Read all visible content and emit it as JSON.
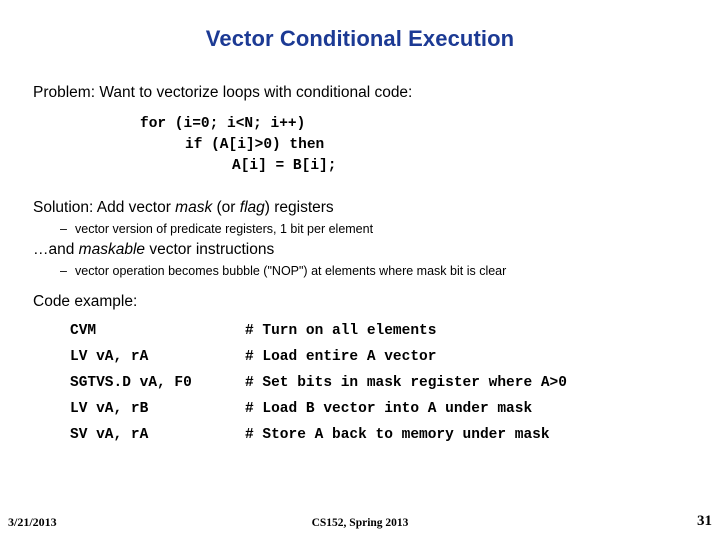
{
  "slide": {
    "title": "Vector Conditional Execution",
    "problem": {
      "heading": "Problem: Want to vectorize loops with conditional code:",
      "code": [
        "for (i=0; i<N; i++)",
        "if (A[i]>0) then",
        "A[i] = B[i];"
      ]
    },
    "solution": {
      "heading_pre": "Solution: Add vector ",
      "heading_em1": "mask",
      "heading_mid": " (or ",
      "heading_em2": "flag",
      "heading_post": ") registers",
      "sub_bullet": "vector version of predicate registers, 1 bit per element",
      "dash": "–"
    },
    "maskable": {
      "heading_pre": "…and ",
      "heading_em": "maskable",
      "heading_post": " vector instructions",
      "sub_bullet": "vector operation becomes bubble (\"NOP\") at elements where mask bit is clear",
      "dash": "–"
    },
    "code_example": {
      "heading": "Code example:",
      "rows": [
        {
          "instruction": "CVM",
          "comment": "# Turn on all elements"
        },
        {
          "instruction": "LV vA, rA",
          "comment": "# Load entire A vector"
        },
        {
          "instruction": "SGTVS.D vA, F0",
          "comment": "# Set bits in mask register where A>0"
        },
        {
          "instruction": "LV vA, rB",
          "comment": "# Load B vector into A under mask"
        },
        {
          "instruction": "SV vA, rA",
          "comment": "# Store A back to memory under mask"
        }
      ]
    }
  },
  "footer": {
    "date": "3/21/2013",
    "course": "CS152, Spring 2013",
    "page_number": "31"
  },
  "colors": {
    "title": "#1c3a94",
    "body_text": "#000000",
    "background": "#ffffff"
  }
}
